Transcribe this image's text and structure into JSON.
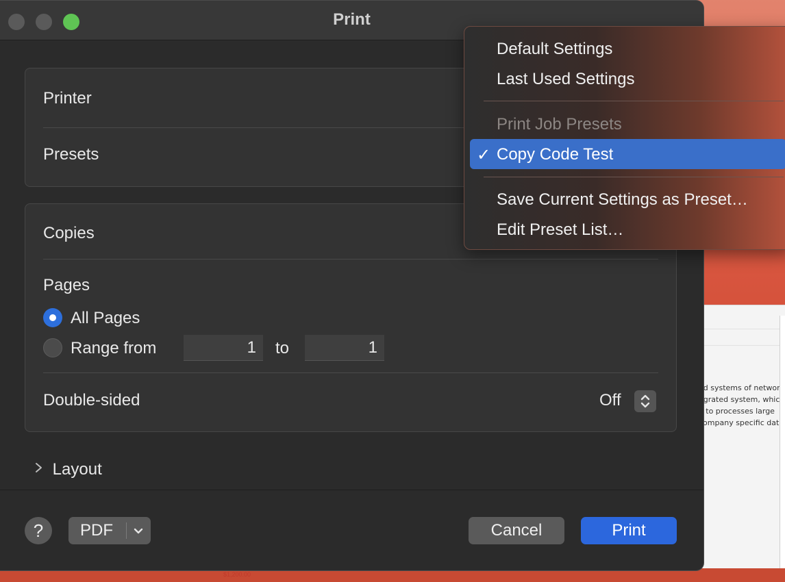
{
  "window": {
    "title": "Print"
  },
  "printer_section": {
    "printer_label": "Printer",
    "presets_label": "Presets"
  },
  "copies_section": {
    "copies_label": "Copies",
    "pages_label": "Pages",
    "all_pages_label": "All Pages",
    "all_pages_selected": true,
    "range_label": "Range from",
    "range_from": "1",
    "range_to_label": "to",
    "range_to": "1",
    "double_sided_label": "Double-sided",
    "double_sided_value": "Off"
  },
  "layout_section": {
    "label": "Layout"
  },
  "footer": {
    "help_label": "?",
    "pdf_label": "PDF",
    "pdf_dropdown_icon": "chevron-down",
    "cancel_label": "Cancel",
    "print_label": "Print"
  },
  "presets_menu": {
    "items": [
      {
        "label": "Default Settings",
        "enabled": true,
        "selected": false
      },
      {
        "label": "Last Used Settings",
        "enabled": true,
        "selected": false
      },
      {
        "label": "Print Job Presets",
        "enabled": false,
        "selected": false
      },
      {
        "label": "Copy Code Test",
        "enabled": true,
        "selected": true
      },
      {
        "label": "Save Current Settings as Preset…",
        "enabled": true,
        "selected": false
      },
      {
        "label": "Edit Preset List…",
        "enabled": true,
        "selected": false
      }
    ],
    "check_mark": "✓",
    "highlight_color": "#3a6fc9"
  },
  "background_document": {
    "lines": [
      "ed systems of networ",
      "egrated system, whic",
      "e to processes large",
      "company specific dat",
      "$1,200.00"
    ]
  },
  "colors": {
    "accent": "#2c67dd",
    "zoom_green": "#5fc454"
  }
}
